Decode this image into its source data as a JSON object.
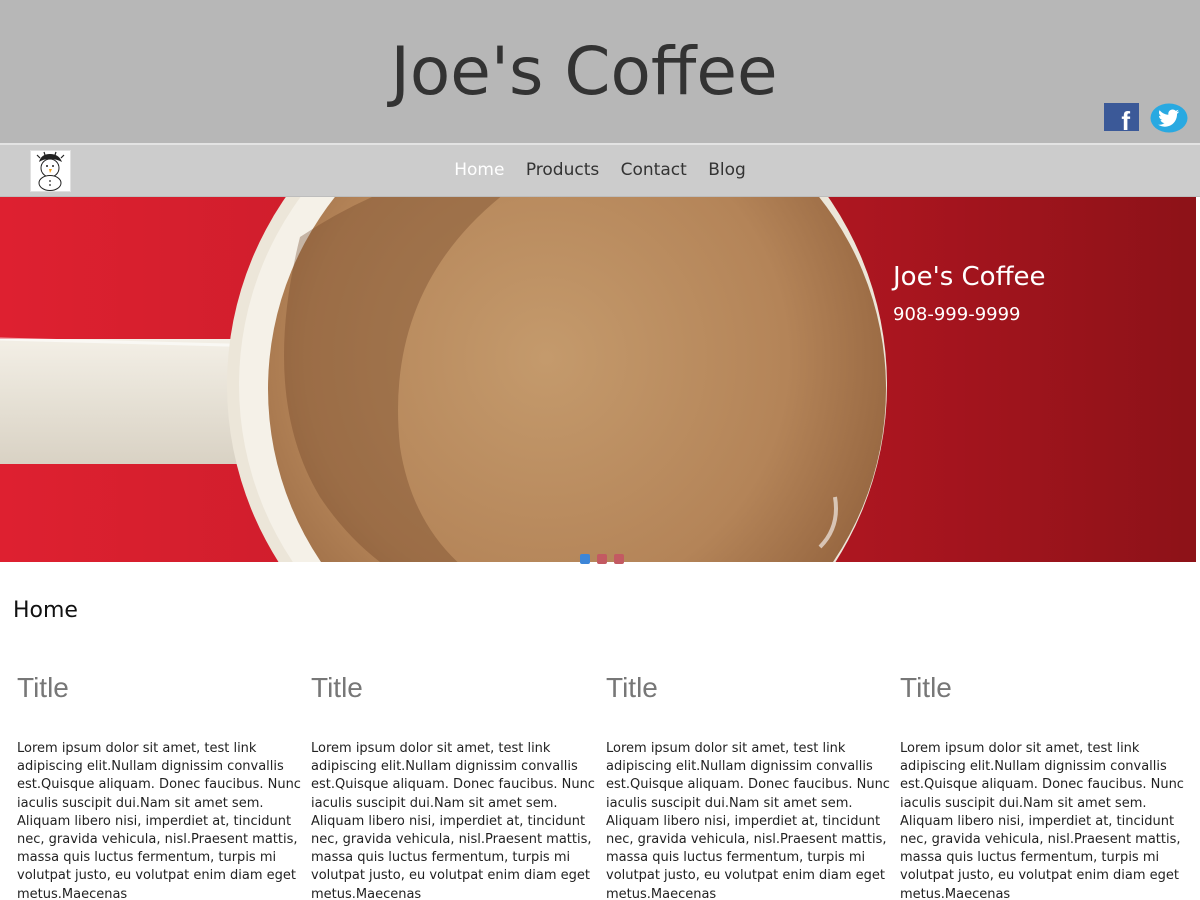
{
  "header": {
    "site_title": "Joe's Coffee",
    "social": [
      {
        "icon": "facebook-icon",
        "color": "#3b5998",
        "glyph": "f"
      },
      {
        "icon": "twitter-icon",
        "color": "#29a9e1"
      }
    ]
  },
  "nav": {
    "logo": "snowman-logo",
    "items": [
      {
        "label": "Home",
        "active": true
      },
      {
        "label": "Products"
      },
      {
        "label": "Contact"
      },
      {
        "label": "Blog"
      }
    ]
  },
  "hero": {
    "caption_title": "Joe's Coffee",
    "caption_phone": "908-999-9999",
    "slide_count": 3,
    "active_slide": 1,
    "colors": {
      "background": "#c81d2a",
      "active_dot": "#3d86d8"
    }
  },
  "main": {
    "heading": "Home",
    "columns": [
      {
        "title": "Title",
        "text_before": "Lorem ipsum dolor sit amet, ",
        "link": "test link",
        "text_after": " adipiscing elit.Nullam dignissim convallis est.Quisque aliquam. Donec faucibus. Nunc iaculis suscipit dui.Nam sit amet sem. Aliquam libero nisi, imperdiet at, tincidunt nec, gravida vehicula, nisl.Praesent mattis, massa quis luctus fermentum, turpis mi volutpat justo, eu volutpat enim diam eget metus.Maecenas"
      },
      {
        "title": "Title",
        "text_before": "Lorem ipsum dolor sit amet, ",
        "link": "test link",
        "text_after": " adipiscing elit.Nullam dignissim convallis est.Quisque aliquam. Donec faucibus. Nunc iaculis suscipit dui.Nam sit amet sem. Aliquam libero nisi, imperdiet at, tincidunt nec, gravida vehicula, nisl.Praesent mattis, massa quis luctus fermentum, turpis mi volutpat justo, eu volutpat enim diam eget metus.Maecenas"
      },
      {
        "title": "Title",
        "text_before": "Lorem ipsum dolor sit amet, ",
        "link": "test link",
        "text_after": " adipiscing elit.Nullam dignissim convallis est.Quisque aliquam. Donec faucibus. Nunc iaculis suscipit dui.Nam sit amet sem. Aliquam libero nisi, imperdiet at, tincidunt nec, gravida vehicula, nisl.Praesent mattis, massa quis luctus fermentum, turpis mi volutpat justo, eu volutpat enim diam eget metus.Maecenas"
      },
      {
        "title": "Title",
        "text_before": "Lorem ipsum dolor sit amet, ",
        "link": "test link",
        "text_after": " adipiscing elit.Nullam dignissim convallis est.Quisque aliquam. Donec faucibus. Nunc iaculis suscipit dui.Nam sit amet sem. Aliquam libero nisi, imperdiet at, tincidunt nec, gravida vehicula, nisl.Praesent mattis, massa quis luctus fermentum, turpis mi volutpat justo, eu volutpat enim diam eget metus.Maecenas"
      }
    ]
  }
}
